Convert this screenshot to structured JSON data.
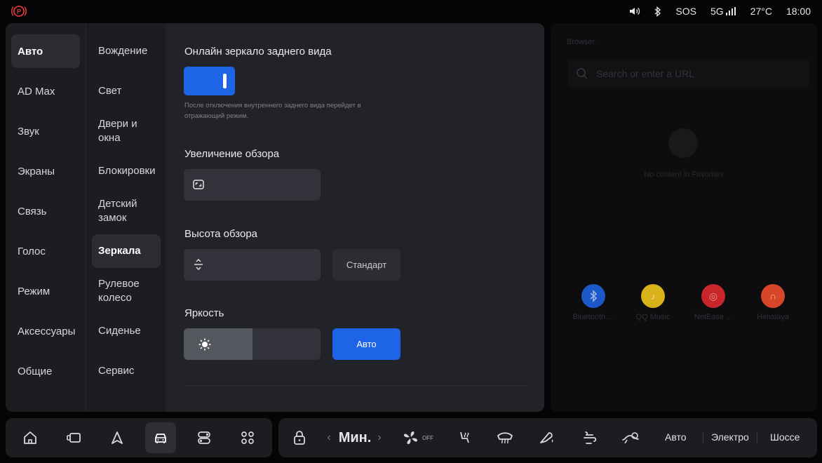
{
  "status_bar": {
    "sos": "SOS",
    "network": "5G",
    "temperature": "27°C",
    "time": "18:00",
    "icons": [
      "parking-brake-icon",
      "volume-icon",
      "bluetooth-icon",
      "signal-icon"
    ],
    "warning_color": "#d8383c"
  },
  "settings": {
    "categories": [
      {
        "label": "Авто",
        "active": true
      },
      {
        "label": "AD Max"
      },
      {
        "label": "Звук"
      },
      {
        "label": "Экраны"
      },
      {
        "label": "Связь"
      },
      {
        "label": "Голос"
      },
      {
        "label": "Режим"
      },
      {
        "label": "Аксессуары"
      },
      {
        "label": "Общие"
      }
    ],
    "subcategories": [
      {
        "label": "Вождение"
      },
      {
        "label": "Свет"
      },
      {
        "label": "Двери и окна"
      },
      {
        "label": "Блокировки"
      },
      {
        "label": "Детский замок"
      },
      {
        "label": "Зеркала",
        "active": true
      },
      {
        "label": "Рулевое колесо"
      },
      {
        "label": "Сиденье"
      },
      {
        "label": "Сервис"
      }
    ],
    "mirror": {
      "online_mirror_title": "Онлайн зеркало заднего вида",
      "online_mirror_enabled": true,
      "online_mirror_note": "После отключения внутреннего заднего вида перейдет в отражающий режим.",
      "view_zoom_title": "Увеличение обзора",
      "view_height_title": "Высота обзора",
      "standard_button": "Стандарт",
      "brightness_title": "Яркость",
      "brightness_level": 0.5,
      "auto_button": "Авто"
    },
    "accent_color": "#1e64e6"
  },
  "browser": {
    "title": "Browser",
    "search_placeholder": "Search or enter a URL",
    "empty_text": "No content in Favorites",
    "apps": [
      {
        "label": "Bluetooth ...",
        "icon": "bluetooth-icon",
        "color": "#1d58c8"
      },
      {
        "label": "QQ Music",
        "icon": "music-note-icon",
        "color": "#d8b21a"
      },
      {
        "label": "NetEase ...",
        "icon": "netease-icon",
        "color": "#c8262a"
      },
      {
        "label": "Himalaya",
        "icon": "himalaya-icon",
        "color": "#d8462a"
      }
    ]
  },
  "dock": {
    "nav_icons": [
      "home-icon",
      "screen-icon",
      "navigation-icon",
      "car-icon",
      "toggles-icon",
      "apps-icon"
    ],
    "active_nav": "car-icon",
    "fan_label": "Мин.",
    "fan_off_label": "OFF",
    "drive_modes": [
      "Авто",
      "Электро",
      "Шоссе"
    ]
  }
}
